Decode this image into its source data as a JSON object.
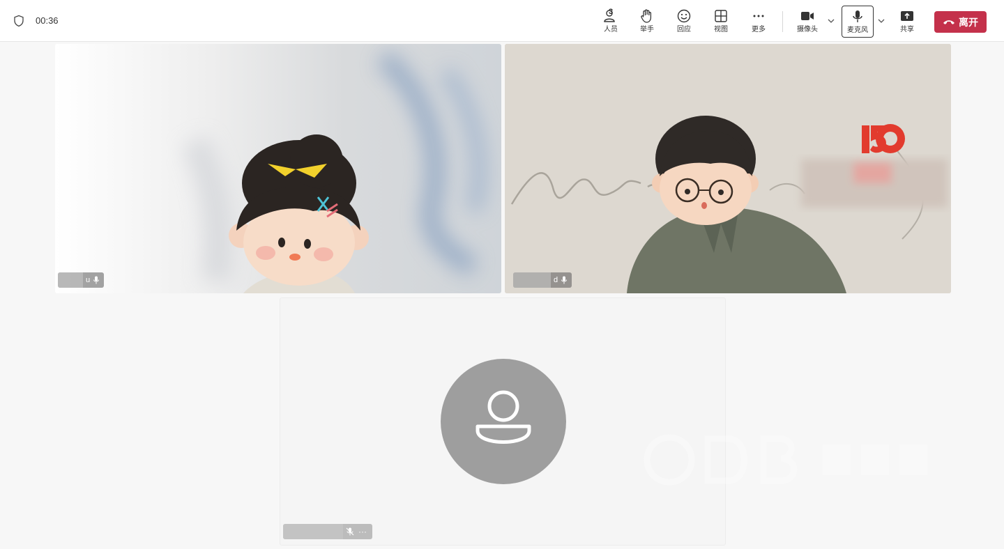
{
  "call": {
    "timer": "00:36"
  },
  "toolbar": {
    "people": {
      "label": "人员",
      "count": "3"
    },
    "raise_hand": {
      "label": "举手"
    },
    "react": {
      "label": "回应"
    },
    "view": {
      "label": "视图"
    },
    "more": {
      "label": "更多"
    },
    "camera": {
      "label": "摄像头"
    },
    "mic": {
      "label": "麦克风"
    },
    "share": {
      "label": "共享"
    },
    "leave": {
      "label": "离开"
    }
  },
  "participants": [
    {
      "name_suffix": "u",
      "mic": "on",
      "video": "on"
    },
    {
      "name_suffix": "d",
      "mic": "on",
      "video": "on"
    },
    {
      "name_suffix": "",
      "mic": "muted",
      "video": "off",
      "more": "···"
    }
  ],
  "colors": {
    "leave_red": "#c4314b",
    "avatar_gray": "#9e9e9e",
    "topbar_bg": "#ffffff",
    "stage_bg": "#f7f7f7"
  },
  "icons": [
    "shield-icon",
    "people-icon",
    "hand-icon",
    "emoji-icon",
    "grid-icon",
    "more-icon",
    "camera-icon",
    "mic-icon",
    "share-icon",
    "phone-hangup-icon",
    "chevron-down-icon"
  ]
}
